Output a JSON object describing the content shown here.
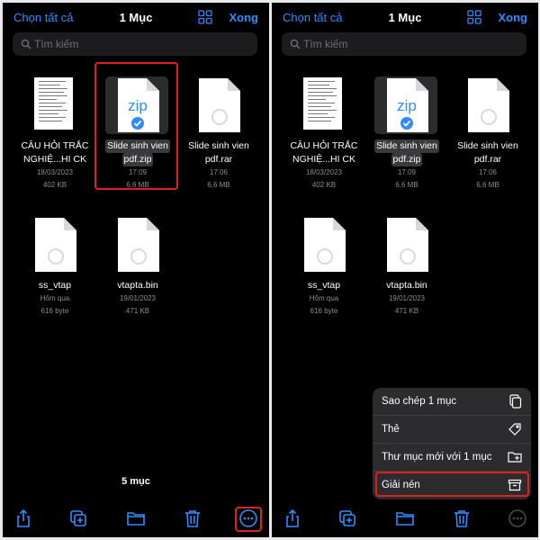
{
  "header": {
    "select_all": "Chọn tất cả",
    "title": "1 Mục",
    "done": "Xong"
  },
  "search": {
    "placeholder": "Tìm kiếm"
  },
  "files": [
    {
      "line1": "CÂU HỎI TRẮC",
      "line2": "NGHIỆ...HI CK",
      "date": "18/03/2023",
      "size": "402 KB",
      "type": "document"
    },
    {
      "line1": "Slide sinh vien",
      "line2": "pdf.zip",
      "date": "17:09",
      "size": "6,6 MB",
      "type": "zip",
      "selected": true,
      "icon_label": "zip"
    },
    {
      "line1": "Slide sinh vien",
      "line2": "pdf.rar",
      "date": "17:06",
      "size": "6,6 MB",
      "type": "generic"
    },
    {
      "line1": "ss_vtap",
      "line2": "",
      "date": "Hôm qua",
      "size": "616 byte",
      "type": "generic"
    },
    {
      "line1": "vtapta.bin",
      "line2": "",
      "date": "19/01/2023",
      "size": "471 KB",
      "type": "generic"
    }
  ],
  "footer": {
    "count": "5 mục"
  },
  "toolbar": {
    "icons": [
      "share-icon",
      "duplicate-icon",
      "folder-icon",
      "trash-icon",
      "more-icon"
    ]
  },
  "menu": {
    "items": [
      {
        "label": "Sao chép 1 mục",
        "icon": "copy-icon"
      },
      {
        "label": "Thẻ",
        "icon": "tag-icon"
      },
      {
        "label": "Thư mục mới với 1 mục",
        "icon": "folder-add-icon"
      },
      {
        "label": "Giải nén",
        "icon": "archive-icon"
      }
    ]
  },
  "colors": {
    "accent": "#2f8cff",
    "highlight": "#e0201e",
    "background": "#000000",
    "menu": "#2c2c2e"
  }
}
